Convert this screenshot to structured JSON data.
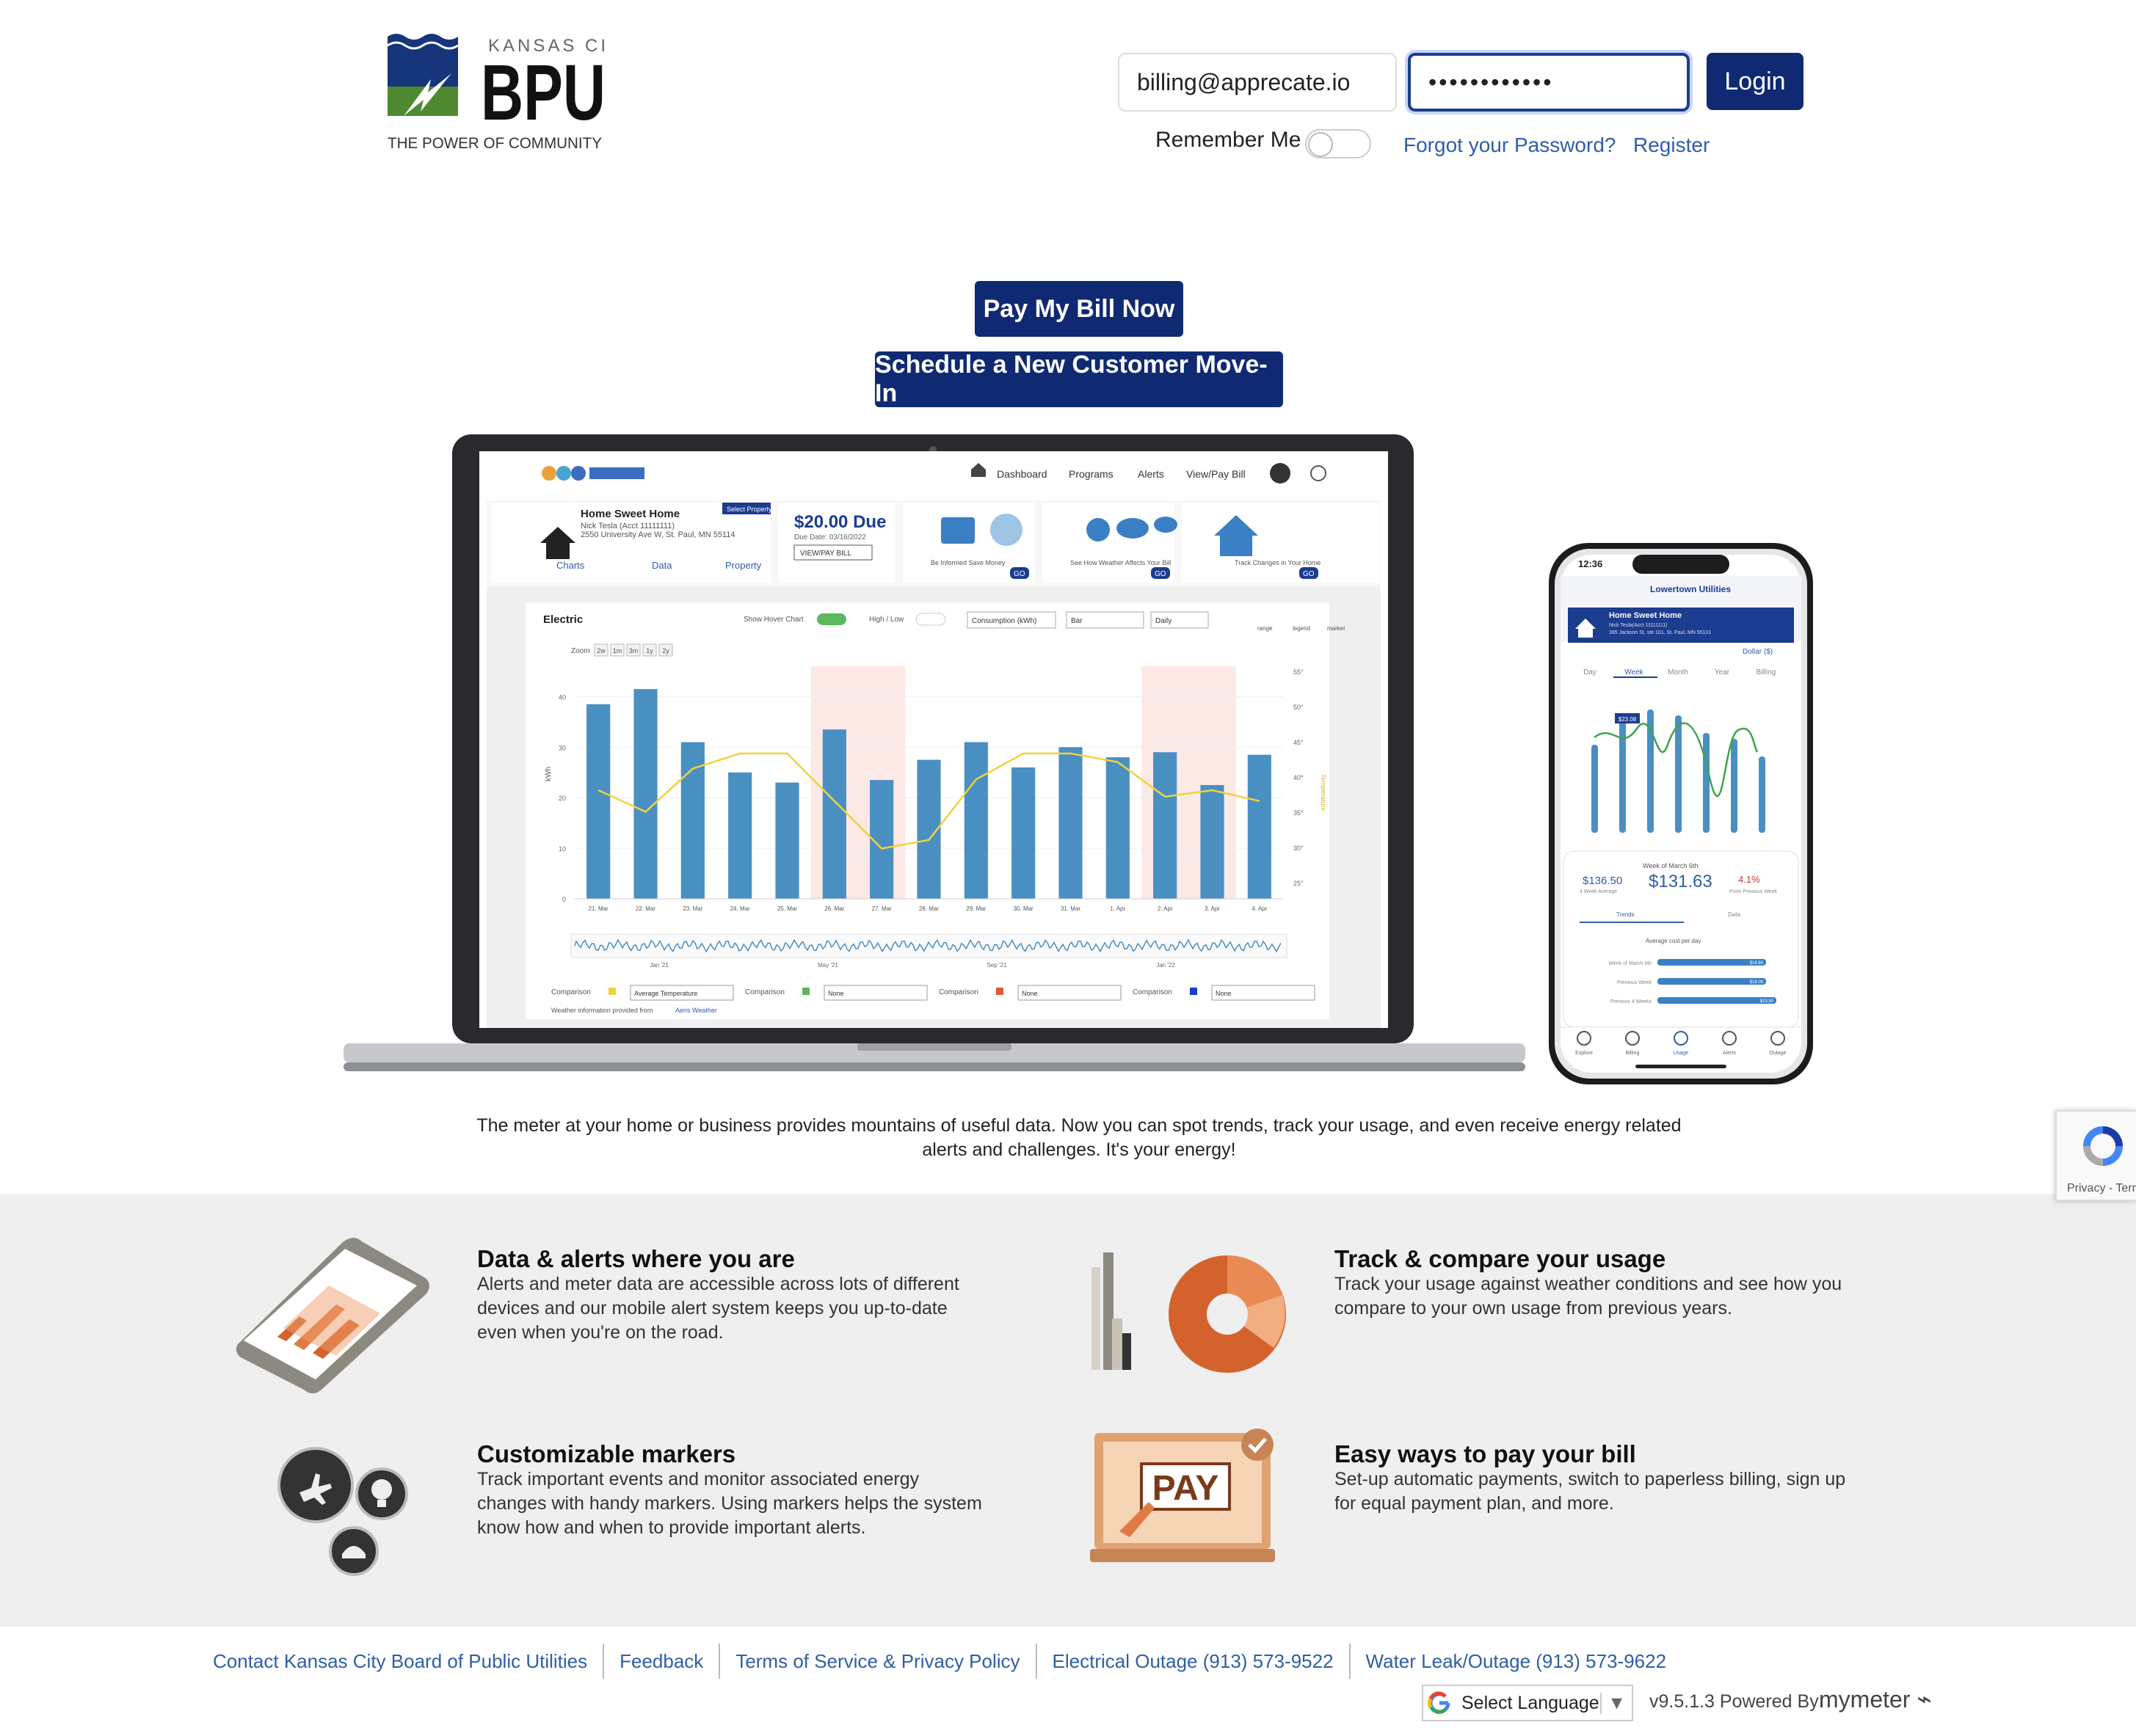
{
  "logo": {
    "top_text": "KANSAS CITY",
    "main_text": "BPU",
    "tagline": "THE POWER OF COMMUNITY"
  },
  "login": {
    "email_value": "billing@apprecate.io",
    "password_value": "••••••••••••",
    "login_label": "Login",
    "remember_label": "Remember Me",
    "forgot_label": "Forgot your Password?",
    "register_label": "Register"
  },
  "cta": {
    "pay_now": "Pay My Bill Now",
    "move_in": "Schedule a New Customer Move-In"
  },
  "hero": {
    "nav": [
      "Dashboard",
      "Programs",
      "Alerts",
      "View/Pay Bill"
    ],
    "home_title": "Home Sweet Home",
    "home_sub1": "Nick Tesla (Acct 11111111)",
    "home_sub2": "2550 University Ave W, St. Paul, MN 55114",
    "select_property": "Select Property",
    "tabs": [
      "Charts",
      "Data",
      "Property"
    ],
    "due": "$20.00 Due",
    "due_date": "Due Date: 03/16/2022",
    "view_pay": "VIEW/PAY BILL",
    "card1": "Be Informed Save Money",
    "card2": "See How Weather Affects Your Bill",
    "card3": "Track Changes in Your Home",
    "go": "GO",
    "electric": "Electric",
    "show_hover": "Show Hover Chart",
    "high_low": "High / Low",
    "consumption": "Consumption (kWh)",
    "bar": "Bar",
    "daily": "Daily",
    "icons": [
      "range",
      "legend",
      "marker"
    ],
    "zoom": "Zoom",
    "zoom_opts": [
      "2w",
      "1m",
      "3m",
      "1y",
      "2y"
    ],
    "ylabel": "kWh",
    "y_ticks": [
      "40",
      "30",
      "20",
      "10",
      "0"
    ],
    "r_ticks": [
      "55°",
      "50°",
      "45°",
      "40°",
      "35°",
      "30°",
      "25°"
    ],
    "r_label": "Temperature",
    "x_labels": [
      "21. Mar",
      "22. Mar",
      "23. Mar",
      "24. Mar",
      "25. Mar",
      "26. Mar",
      "27. Mar",
      "28. Mar",
      "29. Mar",
      "30. Mar",
      "31. Mar",
      "1. Apr",
      "2. Apr",
      "3. Apr",
      "4. Apr"
    ],
    "bars": [
      38.5,
      41.5,
      31,
      25,
      23,
      33.5,
      23.5,
      27.5,
      31,
      26,
      30,
      28,
      29,
      22.5,
      28.5
    ],
    "nav_labels": [
      "Jan '21",
      "May '21",
      "Sep '21",
      "Jan '22"
    ],
    "comparison": "Comparison",
    "cmp_values": [
      "Average Temperature",
      "None",
      "None",
      "None"
    ],
    "weather_note": "Weather information provided from",
    "weather_link": "Aeris Weather",
    "phone": {
      "time": "12:36",
      "brand": "Lowertown Utilities",
      "title": "Home Sweet Home",
      "sub1": "Nick Tesla(Acct 11111111)",
      "sub2": "395 Jackson St, ste 101, St. Paul, MN 55101",
      "dollar": "Dollar ($)",
      "tabs": [
        "Day",
        "Week",
        "Month",
        "Year",
        "Billing"
      ],
      "bars": [
        30,
        38,
        42,
        40,
        34,
        32,
        26
      ],
      "bar_label": "$23.08",
      "week_of": "Week of March 6th",
      "avg_val": "$136.50",
      "avg_label": "4 Week Average",
      "main_val": "$131.63",
      "pct": "4.1%",
      "pct_label": "From Previous Week",
      "subtabs": [
        "Trends",
        "Data"
      ],
      "cost_title": "Average cost per day",
      "rows": [
        {
          "label": "Week of March 6th",
          "val": "$18.80"
        },
        {
          "label": "Previous Week",
          "val": "$18.08"
        },
        {
          "label": "Previous 4 Weeks",
          "val": "$19.50"
        }
      ],
      "bottom": [
        "Explore",
        "Billing",
        "Usage",
        "Alerts",
        "Outage"
      ]
    }
  },
  "intro": "The meter at your home or business provides mountains of useful data. Now you can spot trends, track your usage, and even receive energy related alerts and challenges. It's your energy!",
  "features": [
    {
      "title": "Data & alerts where you are",
      "desc": "Alerts and meter data are accessible across lots of different devices and our mobile alert system keeps you up-to-date even when you're on the road."
    },
    {
      "title": "Track & compare your usage",
      "desc": "Track your usage against weather conditions and see how you compare to your own usage from previous years."
    },
    {
      "title": "Customizable markers",
      "desc": "Track important events and monitor associated energy changes with handy markers. Using markers helps the system know how and when to provide important alerts."
    },
    {
      "title": "Easy ways to pay your bill",
      "desc": "Set-up automatic payments, switch to paperless billing, sign up for equal payment plan, and more."
    }
  ],
  "pay_icon_text": "PAY",
  "footer": {
    "links": [
      "Contact Kansas City Board of Public Utilities",
      "Feedback",
      "Terms of Service & Privacy Policy",
      "Electrical Outage (913) 573-9522",
      "Water Leak/Outage (913) 573-9622"
    ],
    "language": "Select Language",
    "version": "v9.5.1.3 Powered By:",
    "brand": "mymeter"
  },
  "recaptcha": "Privacy - Terms",
  "colors": {
    "navy": "#0f2a72",
    "link": "#2f5ea6",
    "bar": "#4a8fc2",
    "temp": "#f2d23c",
    "highlight": "#fbe9e6",
    "orange": "#d4622c"
  }
}
